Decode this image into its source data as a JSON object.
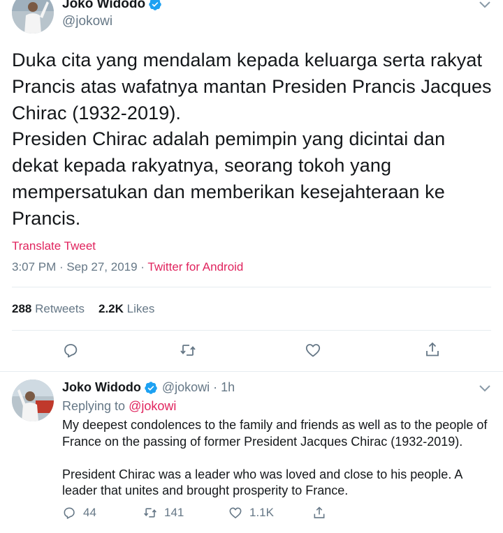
{
  "main_tweet": {
    "display_name": "Joko Widodo",
    "handle": "@jokowi",
    "text_lines": [
      "Duka cita yang mendalam kepada keluarga serta rakyat",
      "Prancis atas wafatnya mantan Presiden Prancis Jacques",
      "Chirac (1932-2019).",
      "Presiden Chirac adalah pemimpin yang dicintai dan",
      "dekat kepada rakyatnya, seorang tokoh yang",
      "mempersatukan dan memberikan kesejahteraan ke",
      "Prancis."
    ],
    "translate_label": "Translate Tweet",
    "timestamp": "3:07 PM · Sep 27, 2019 · ",
    "source": "Twitter for Android",
    "retweets_count": "288",
    "retweets_label": "Retweets",
    "likes_count": "2.2K",
    "likes_label": "Likes",
    "icons": [
      "reply-icon",
      "retweet-icon",
      "like-icon",
      "share-icon",
      "verified-icon",
      "caret-down-icon"
    ]
  },
  "reply_tweet": {
    "display_name": "Joko Widodo",
    "handle_time": "@jokowi · 1h",
    "replying_prefix": "Replying to ",
    "replying_mention": "@jokowi",
    "text_lines_p1": [
      "My deepest condolences to the family and friends as well as to the people of",
      "France on the passing of former President Jacques Chirac (1932-2019)."
    ],
    "text_lines_p2": [
      "President Chirac was a leader who was loved and close to his people. A",
      "leader that unites and brought prosperity to France."
    ],
    "reply_count": "44",
    "retweet_count": "141",
    "like_count": "1.1K"
  },
  "colors": {
    "accent": "#e0245e",
    "muted": "#657786",
    "verified": "#1da1f2",
    "divider": "#e6ecf0"
  }
}
